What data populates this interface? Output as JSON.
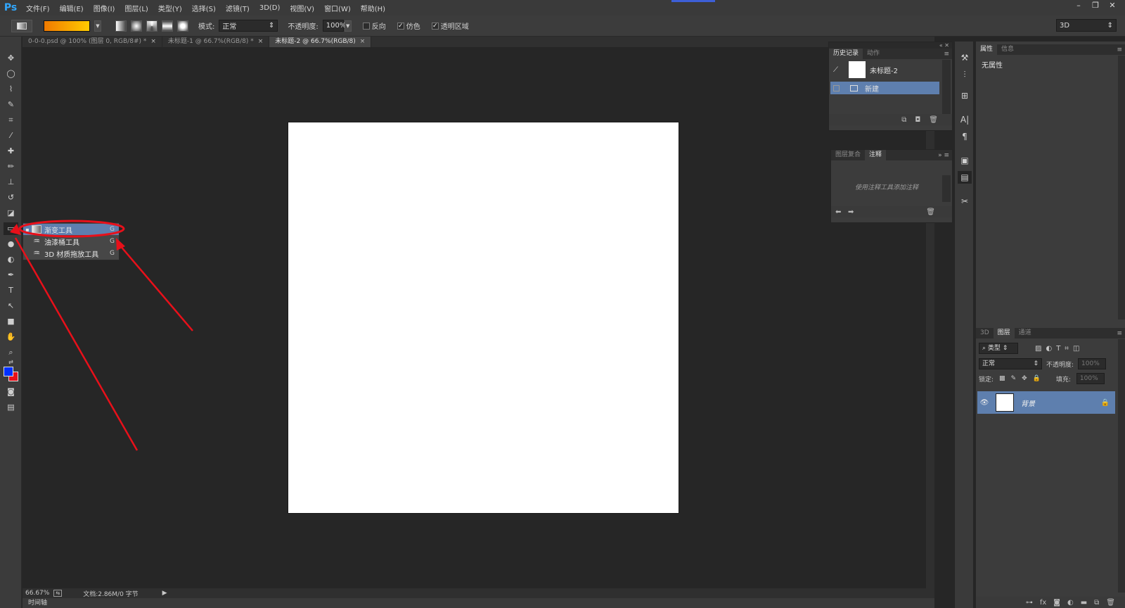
{
  "app": {
    "logo": "Ps",
    "menus": [
      "文件(F)",
      "编辑(E)",
      "图像(I)",
      "图层(L)",
      "类型(Y)",
      "选择(S)",
      "滤镜(T)",
      "3D(D)",
      "视图(V)",
      "窗口(W)",
      "帮助(H)"
    ]
  },
  "options": {
    "mode_label": "模式:",
    "mode_value": "正常",
    "opacity_label": "不透明度:",
    "opacity_value": "100%",
    "reverse_label": "反向",
    "dither_label": "仿色",
    "transparency_label": "透明区域",
    "workspace": "3D",
    "gradient_colors": [
      "#f07a00",
      "#ffcc00"
    ]
  },
  "tabs": [
    {
      "label": "0-0-0.psd @ 100% (图层 0, RGB/8#) *",
      "active": false
    },
    {
      "label": "未标题-1 @ 66.7%(RGB/8) *",
      "active": false
    },
    {
      "label": "未标题-2 @ 66.7%(RGB/8)",
      "active": true
    }
  ],
  "colors": {
    "foreground": "#0030ff",
    "background": "#e8101a",
    "selection": "#5e7fae",
    "annotation": "#e8101a"
  },
  "flyout": [
    {
      "label": "渐变工具",
      "key": "G",
      "selected": true
    },
    {
      "label": "油漆桶工具",
      "key": "G",
      "selected": false
    },
    {
      "label": "3D 材质拖放工具",
      "key": "G",
      "selected": false
    }
  ],
  "history_panel": {
    "tabs": [
      "历史记录",
      "动作"
    ],
    "snapshot_label": "未标题-2",
    "rows": [
      {
        "label": "新建"
      }
    ]
  },
  "notes_panel": {
    "tabs": [
      "图层复合",
      "注释"
    ],
    "hint": "使用注释工具添加注释"
  },
  "properties_panel": {
    "tabs": [
      "属性",
      "信息"
    ],
    "empty_text": "无属性"
  },
  "layers_panel": {
    "tabs": [
      "3D",
      "图层",
      "通道"
    ],
    "filter_label": "类型",
    "blend_mode": "正常",
    "opacity_label": "不透明度:",
    "opacity_value": "100%",
    "lock_label": "锁定:",
    "fill_label": "填充:",
    "fill_value": "100%",
    "layers": [
      {
        "name": "背景"
      }
    ]
  },
  "status": {
    "zoom": "66.67%",
    "doc_info": "文档:2.86M/0 字节",
    "timeline_label": "时间轴"
  }
}
